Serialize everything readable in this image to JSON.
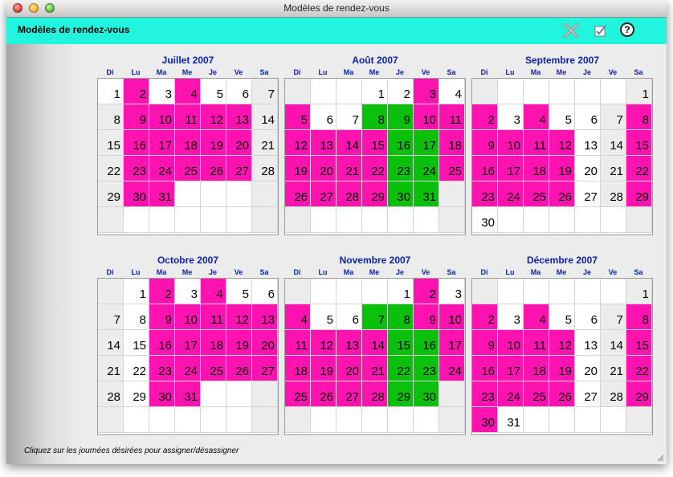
{
  "window": {
    "title": "Modèles de rendez-vous"
  },
  "header": {
    "title": "Modèles de rendez-vous",
    "help_label": "?"
  },
  "day_headers": [
    "Di",
    "Lu",
    "Ma",
    "Me",
    "Je",
    "Ve",
    "Sa"
  ],
  "status_text": "Cliquez sur les journées désirées pour assigner/désassigner",
  "colors": {
    "header_bg": "#22f5dd",
    "assigned": "#ff13b0",
    "selected": "#0ac00a",
    "weekend": "#ececec",
    "title_blue": "#0b20b0"
  },
  "legend_states": {
    "P": "assigned (pink)",
    "G": "green",
    "W": "white",
    "E": "weekend/unassigned (grey)"
  },
  "months": [
    {
      "name": "Juillet 2007",
      "start": 0,
      "days": 31,
      "states": "WPWPWWEEPPPPPEEPPPPPEEPPPPPEEPPP"
    },
    {
      "name": "Août 2007",
      "start": 3,
      "days": 31,
      "states": "WWPWPWWGGPPPPPPGGPPPPPGGPPPPPGGPPPPP"
    },
    {
      "name": "Septembre 2007",
      "start": 6,
      "days": 30,
      "states": "EPWPWWEPPPPPWEPPPPPWEPPPPPWEP"
    },
    {
      "name": "Octobre 2007",
      "start": 1,
      "days": 31,
      "states": "WPWPWWEWPPPPPEWPPPPPEWPPPPPEWPP"
    },
    {
      "name": "Novembre 2007",
      "start": 4,
      "days": 30,
      "states": "WPWPWWGGPPPPPPGGPPPPPGGPPPPPGGP"
    },
    {
      "name": "Décembre 2007",
      "start": 6,
      "days": 31,
      "states": "EPWPWWEPPPPPWEPPPPPWEPPPPPWEPP"
    }
  ]
}
